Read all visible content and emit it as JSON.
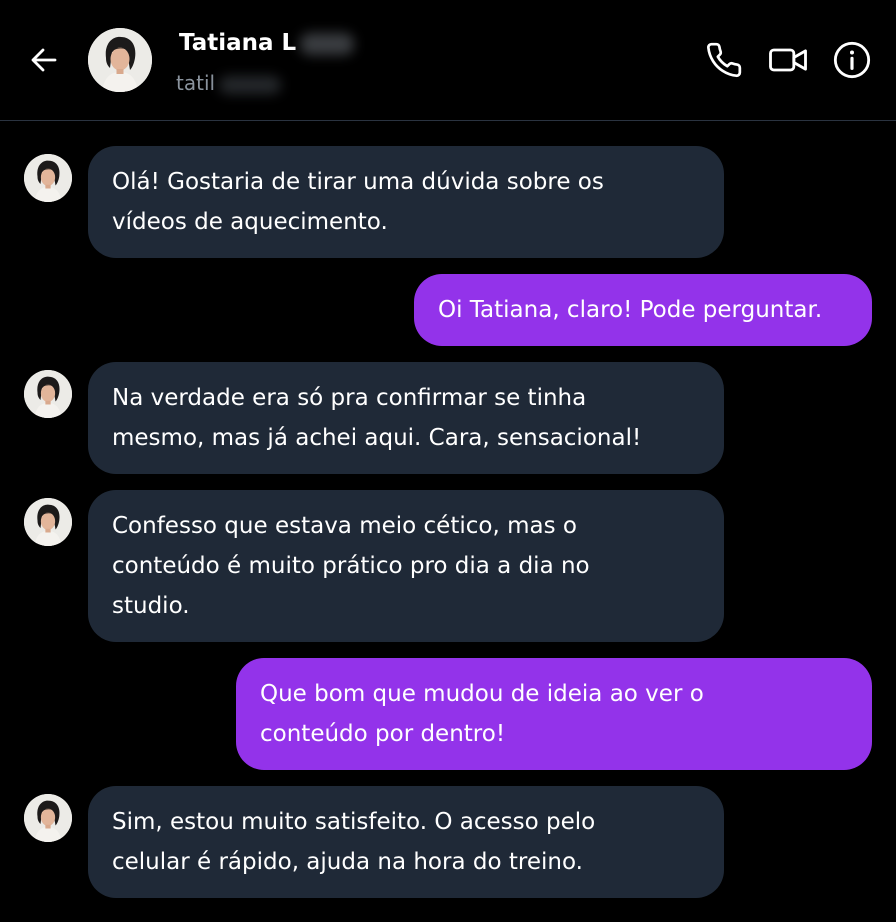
{
  "header": {
    "contact_name": "Tatiana L",
    "contact_handle": "tatil"
  },
  "icons": {
    "back": "arrow-left-icon",
    "call": "phone-icon",
    "video": "video-camera-icon",
    "info": "info-circle-icon"
  },
  "colors": {
    "background": "#000000",
    "incoming_bubble": "#1f2937",
    "outgoing_bubble": "#9333ea",
    "divider": "#2a3340",
    "handle_text": "#8a939d"
  },
  "messages": [
    {
      "from": "contact",
      "text": "Olá! Gostaria de tirar uma dúvida sobre os\nvídeos de aquecimento."
    },
    {
      "from": "me",
      "text": "Oi Tatiana, claro! Pode perguntar."
    },
    {
      "from": "contact",
      "text": "Na verdade era só pra confirmar se tinha\nmesmo, mas já achei aqui. Cara, sensacional!"
    },
    {
      "from": "contact",
      "text": "Confesso que estava meio cético, mas o\nconteúdo é muito prático pro dia a dia no\nstudio."
    },
    {
      "from": "me",
      "text": "Que bom que mudou de ideia ao ver o\nconteúdo por dentro!"
    },
    {
      "from": "contact",
      "text": "Sim, estou muito satisfeito. O acesso pelo\ncelular é rápido, ajuda na hora do treino."
    }
  ]
}
